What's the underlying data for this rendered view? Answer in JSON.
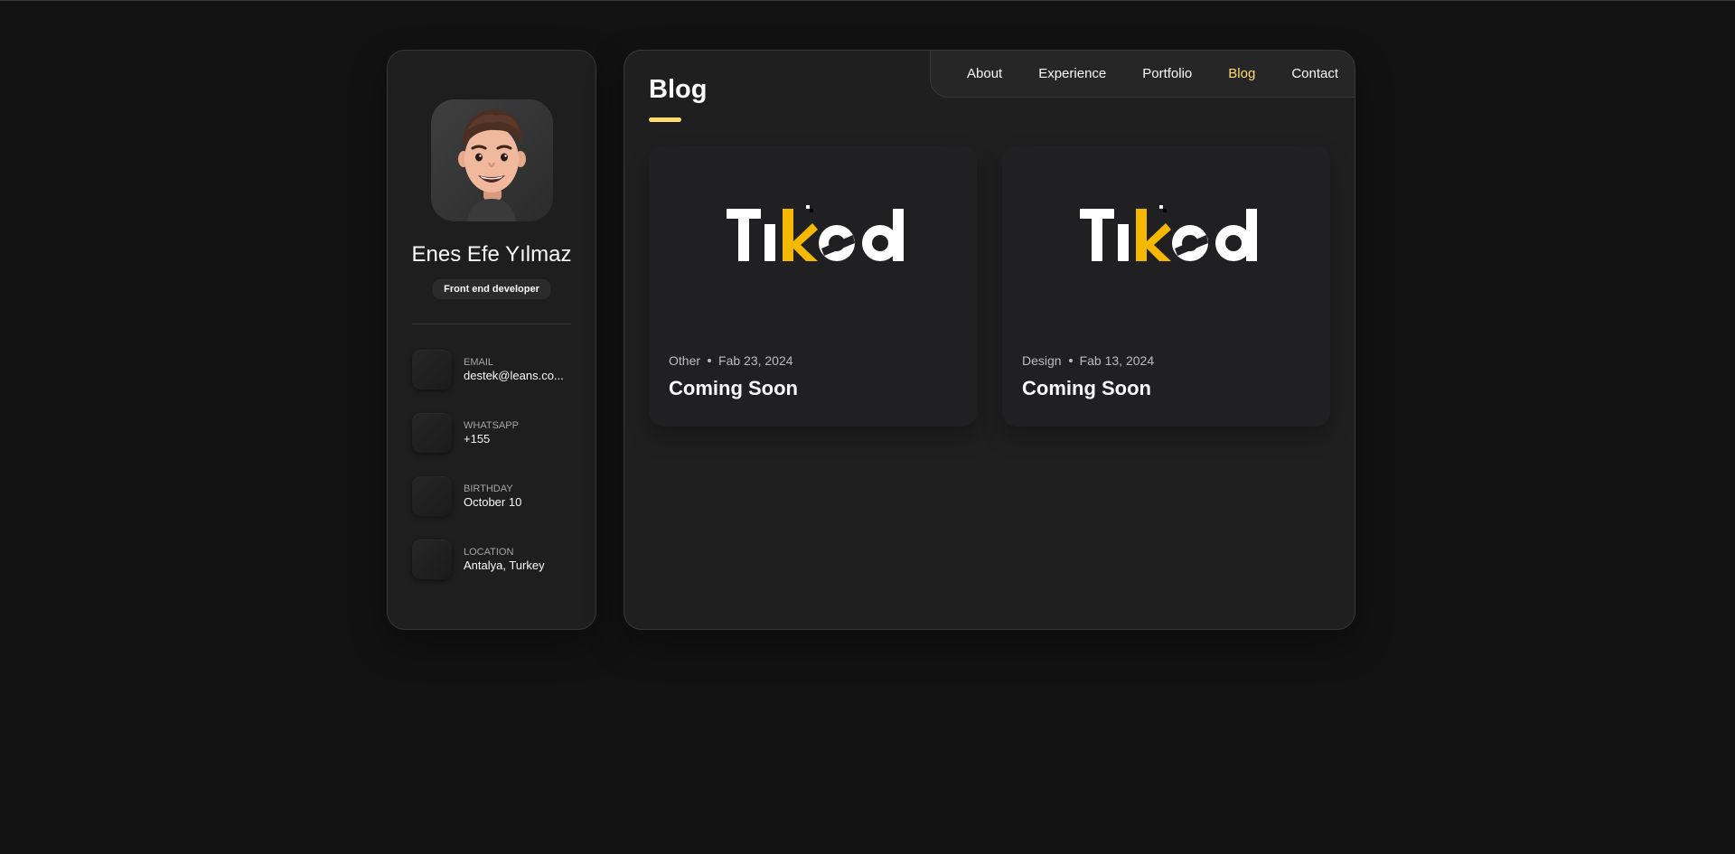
{
  "profile": {
    "name": "Enes Efe Yılmaz",
    "title": "Front end developer",
    "avatar_icon": "memoji-avatar"
  },
  "contacts": [
    {
      "label": "Email",
      "value": "destek@leans.co...",
      "icon": "mail-icon"
    },
    {
      "label": "Whatsapp",
      "value": "+155",
      "icon": "phone-icon"
    },
    {
      "label": "Birthday",
      "value": "October 10",
      "icon": "calendar-icon"
    },
    {
      "label": "Location",
      "value": "Antalya, Turkey",
      "icon": "location-icon"
    }
  ],
  "nav": {
    "items": [
      "About",
      "Experience",
      "Portfolio",
      "Blog",
      "Contact"
    ],
    "active": "Blog"
  },
  "page": {
    "title": "Blog"
  },
  "posts": [
    {
      "category": "Other",
      "date": "Fab 23, 2024",
      "title": "Coming Soon",
      "image_logo": "Tiked"
    },
    {
      "category": "Design",
      "date": "Fab 13, 2024",
      "title": "Coming Soon",
      "image_logo": "Tiked"
    }
  ],
  "colors": {
    "accent": "#ffdb70",
    "background": "#121212",
    "panel": "#1e1e1f",
    "logo_yellow": "#f5b800"
  }
}
